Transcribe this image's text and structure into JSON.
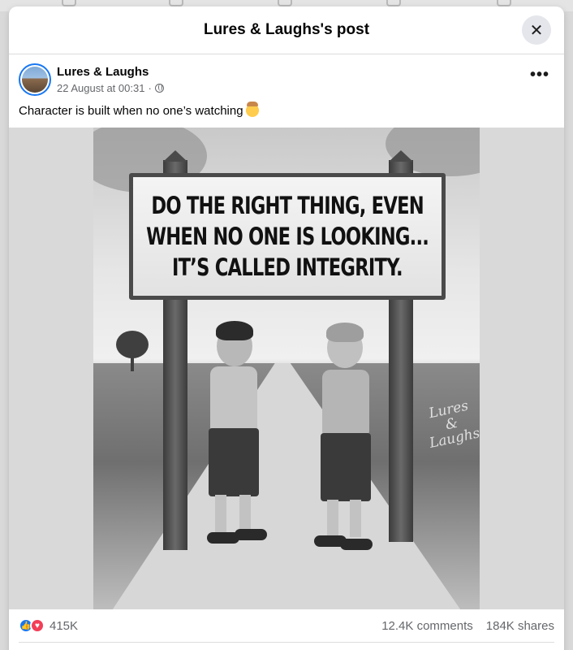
{
  "modal": {
    "title": "Lures & Laughs's post",
    "close_icon": "close-icon"
  },
  "post": {
    "page_name": "Lures & Laughs",
    "timestamp": "22 August at 00:31",
    "separator": "·",
    "audience_icon": "globe-icon",
    "more_label": "•••",
    "caption": "Character is built when no one’s watching",
    "caption_emoji": "cowboy-face-emoji"
  },
  "image": {
    "sign_lines": [
      "DO THE RIGHT THING, EVEN",
      "WHEN NO ONE IS LOOKING...",
      "IT’S CALLED INTEGRITY."
    ],
    "watermark_lines": [
      "Lures",
      "&",
      "Laughs"
    ]
  },
  "stats": {
    "reaction_icons": [
      "like-icon",
      "love-icon"
    ],
    "reaction_count": "415K",
    "comments": "12.4K comments",
    "shares": "184K shares"
  },
  "colors": {
    "accent": "#1877f2",
    "love": "#f33e58",
    "secondary_text": "#65676b"
  }
}
